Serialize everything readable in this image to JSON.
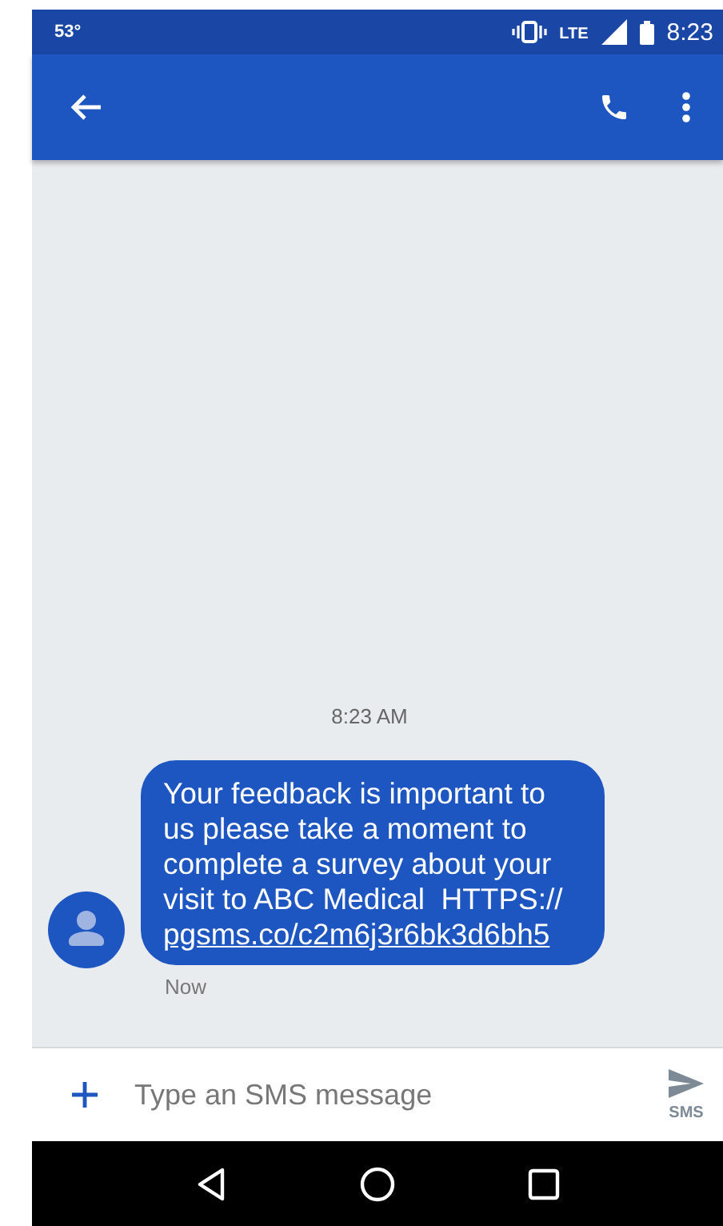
{
  "status_bar": {
    "temperature": "53°",
    "network": "LTE",
    "time": "8:23"
  },
  "conversation": {
    "timestamp": "8:23 AM",
    "messages": [
      {
        "text": "Your feedback is important to us please take a moment to complete a survey about your visit to ABC Medical  HTTPS://",
        "link": "pgsms.co/c2m6j3r6bk3d6bh5",
        "time": "Now"
      }
    ]
  },
  "compose": {
    "placeholder": "Type an SMS message",
    "send_label": "SMS"
  }
}
